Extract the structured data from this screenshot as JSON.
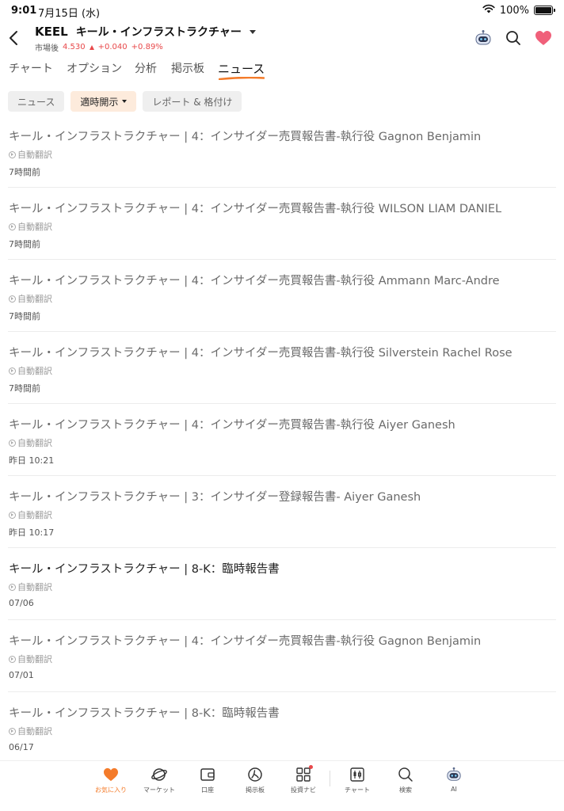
{
  "status_bar": {
    "time": "9:01",
    "date": "7月15日 (水)",
    "battery": "100%"
  },
  "header": {
    "ticker": "KEEL",
    "company": "キール・インフラストラクチャー",
    "session_label": "市場後",
    "price": "4.530",
    "change": "+0.040",
    "change_pct": "+0.89%",
    "accent_red": "#e8484a"
  },
  "tabs": [
    {
      "label": "チャート",
      "active": false
    },
    {
      "label": "オプション",
      "active": false
    },
    {
      "label": "分析",
      "active": false
    },
    {
      "label": "掲示板",
      "active": false
    },
    {
      "label": "ニュース",
      "active": true
    }
  ],
  "filters": [
    {
      "label": "ニュース",
      "active": false
    },
    {
      "label": "適時開示",
      "active": true
    },
    {
      "label": "レポート & 格付け",
      "active": false
    }
  ],
  "news": [
    {
      "title": "キール・インフラストラクチャー | 4：インサイダー売買報告書-執行役 Gagnon Benjamin",
      "translated": "自動翻訳",
      "time": "7時間前",
      "read": true
    },
    {
      "title": "キール・インフラストラクチャー | 4：インサイダー売買報告書-執行役 WILSON LIAM DANIEL",
      "translated": "自動翻訳",
      "time": "7時間前",
      "read": true
    },
    {
      "title": "キール・インフラストラクチャー | 4：インサイダー売買報告書-執行役 Ammann Marc-Andre",
      "translated": "自動翻訳",
      "time": "7時間前",
      "read": true
    },
    {
      "title": "キール・インフラストラクチャー | 4：インサイダー売買報告書-執行役 Silverstein Rachel Rose",
      "translated": "自動翻訳",
      "time": "7時間前",
      "read": true
    },
    {
      "title": "キール・インフラストラクチャー | 4：インサイダー売買報告書-執行役 Aiyer Ganesh",
      "translated": "自動翻訳",
      "time": "昨日 10:21",
      "read": true
    },
    {
      "title": "キール・インフラストラクチャー | 3：インサイダー登録報告書- Aiyer Ganesh",
      "translated": "自動翻訳",
      "time": "昨日 10:17",
      "read": true
    },
    {
      "title": "キール・インフラストラクチャー | 8-K：臨時報告書",
      "translated": "自動翻訳",
      "time": "07/06",
      "read": false
    },
    {
      "title": "キール・インフラストラクチャー | 4：インサイダー売買報告書-執行役 Gagnon Benjamin",
      "translated": "自動翻訳",
      "time": "07/01",
      "read": true
    },
    {
      "title": "キール・インフラストラクチャー | 8-K：臨時報告書",
      "translated": "自動翻訳",
      "time": "06/17",
      "read": true
    }
  ],
  "bottom_nav": [
    {
      "label": "お気に入り",
      "icon": "heart-icon",
      "active": true
    },
    {
      "label": "マーケット",
      "icon": "planet-icon",
      "active": false
    },
    {
      "label": "口座",
      "icon": "wallet-icon",
      "active": false
    },
    {
      "label": "掲示板",
      "icon": "community-icon",
      "active": false
    },
    {
      "label": "投資ナビ",
      "icon": "grid-icon",
      "active": false
    },
    {
      "label": "チャート",
      "icon": "chart-icon",
      "active": false
    },
    {
      "label": "検索",
      "icon": "search-icon",
      "active": false
    },
    {
      "label": "AI",
      "icon": "robot-icon",
      "active": false
    }
  ],
  "colors": {
    "brand_orange": "#f47b2a",
    "heart_pink": "#f0607a"
  }
}
